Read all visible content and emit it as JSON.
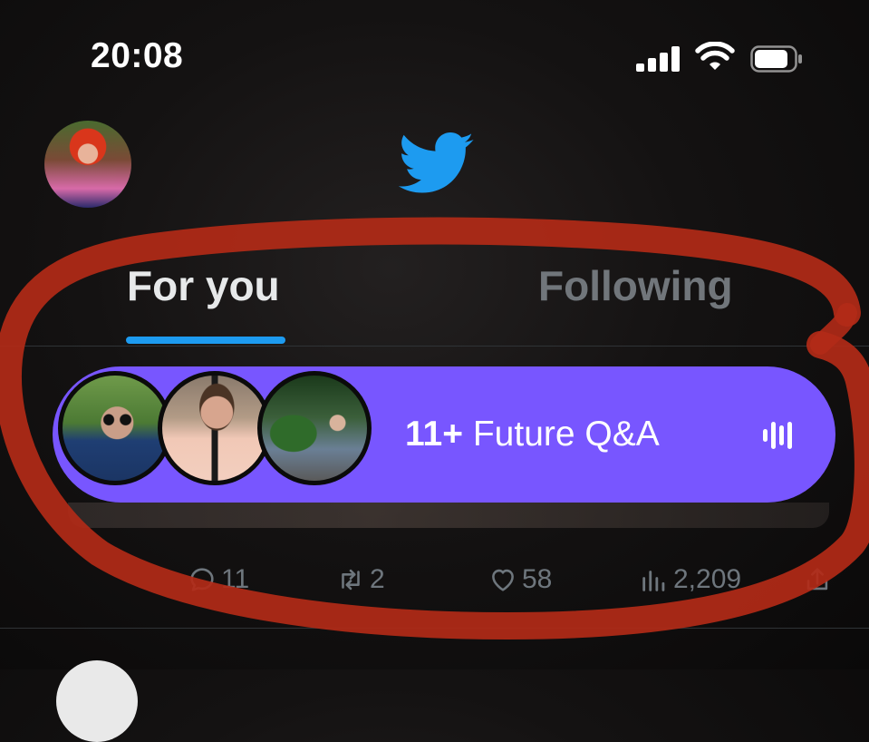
{
  "status_bar": {
    "time": "20:08",
    "icons": [
      "signal-icon",
      "wifi-icon",
      "battery-icon"
    ]
  },
  "header": {
    "logo": "twitter-bird-icon",
    "profile_avatar": "profile-avatar"
  },
  "tabs": [
    {
      "label": "For you",
      "active": true
    },
    {
      "label": "Following",
      "active": false
    }
  ],
  "space": {
    "count": "11+",
    "title": "Future Q&A",
    "icon": "audio-bars-icon",
    "color": "#7856ff"
  },
  "tweet_actions": {
    "replies": "11",
    "retweets": "2",
    "likes": "58",
    "views": "2,209"
  },
  "annotation_color": "#b22a17",
  "accent": "#1d9bf0"
}
